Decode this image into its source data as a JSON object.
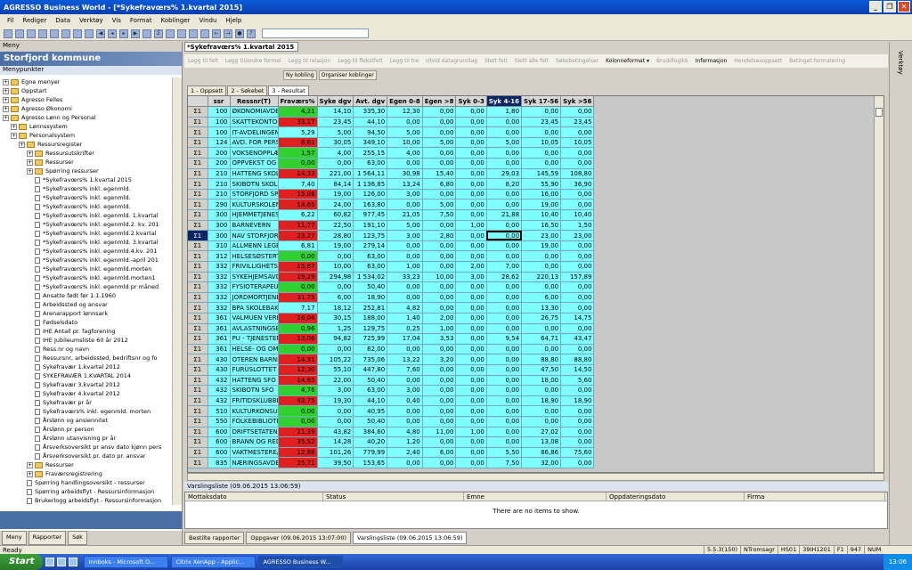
{
  "window": {
    "title": "AGRESSO Business World - [*Sykefravœrs% 1.kvartal 2015]"
  },
  "menu": [
    "Fil",
    "Rediger",
    "Data",
    "Verktøy",
    "Vis",
    "Format",
    "Koblinger",
    "Vindu",
    "Hjelp"
  ],
  "left": {
    "header": "Meny",
    "title": "Storfjord kommune",
    "subheader": "Menypunkter",
    "tree": [
      {
        "indent": 0,
        "type": "folder",
        "label": "Egne menyer"
      },
      {
        "indent": 0,
        "type": "folder",
        "label": "Oppstart"
      },
      {
        "indent": 0,
        "type": "folder",
        "label": "Agresso Felles"
      },
      {
        "indent": 0,
        "type": "folder",
        "label": "Agresso Økonomi"
      },
      {
        "indent": 0,
        "type": "folder",
        "label": "Agresso Lønn og Personal"
      },
      {
        "indent": 1,
        "type": "folder",
        "label": "Lønnssystem"
      },
      {
        "indent": 1,
        "type": "folder",
        "label": "Personalsystem"
      },
      {
        "indent": 2,
        "type": "folder",
        "label": "Ressursregister"
      },
      {
        "indent": 3,
        "type": "folder",
        "label": "Ressursutskrifter"
      },
      {
        "indent": 3,
        "type": "folder",
        "label": "Ressurser"
      },
      {
        "indent": 3,
        "type": "folder",
        "label": "Spørring ressurser"
      },
      {
        "indent": 4,
        "type": "doc",
        "label": "*Sykefravœrs% 1.kvartal 2015"
      },
      {
        "indent": 4,
        "type": "doc",
        "label": "*Sykefravœrs% inkl. egenmld."
      },
      {
        "indent": 4,
        "type": "doc",
        "label": "*Sykefravœrs% inkl. egenmld."
      },
      {
        "indent": 4,
        "type": "doc",
        "label": "*Sykefravœrs% inkl. egenmld."
      },
      {
        "indent": 4,
        "type": "doc",
        "label": "*Sykefravœrs% inkl. egenmld. 1.kvartal"
      },
      {
        "indent": 4,
        "type": "doc",
        "label": "*Sykefravœrs% inkl. egenmld.2. kv. 201"
      },
      {
        "indent": 4,
        "type": "doc",
        "label": "*Sykefravœrs% inkl. egenmld.2.kvartal"
      },
      {
        "indent": 4,
        "type": "doc",
        "label": "*Sykefravœrs% inkl. egenmld. 3.kvartal"
      },
      {
        "indent": 4,
        "type": "doc",
        "label": "*Sykefravœrs% inkl. egenmld.4.kv. 201"
      },
      {
        "indent": 4,
        "type": "doc",
        "label": "*Sykefravœrs% inkl. egenmld.-april 201"
      },
      {
        "indent": 4,
        "type": "doc",
        "label": "*Sykefravœrs% inkl. egenmld.morten"
      },
      {
        "indent": 4,
        "type": "doc",
        "label": "*Sykefravœrs% inkl. egenmld.morten1"
      },
      {
        "indent": 4,
        "type": "doc",
        "label": "*Sykefravœrs% inkl. egenmld pr måned"
      },
      {
        "indent": 4,
        "type": "doc",
        "label": "Ansatte født før 1.1.1960"
      },
      {
        "indent": 4,
        "type": "doc",
        "label": "Arbeidssted og ansvar"
      },
      {
        "indent": 4,
        "type": "doc",
        "label": "Arenarapport lønnsark"
      },
      {
        "indent": 4,
        "type": "doc",
        "label": "Fødselsdato"
      },
      {
        "indent": 4,
        "type": "doc",
        "label": "IHE Antall pr. fagforening"
      },
      {
        "indent": 4,
        "type": "doc",
        "label": "IHE Jubileumsliste 60 år 2012"
      },
      {
        "indent": 4,
        "type": "doc",
        "label": "Ress.nr og navn"
      },
      {
        "indent": 4,
        "type": "doc",
        "label": "Ressursnr, arbeidssted, bedriftsnr og fo"
      },
      {
        "indent": 4,
        "type": "doc",
        "label": "Sykefravær 1.kvartal 2012"
      },
      {
        "indent": 4,
        "type": "doc",
        "label": "SYKEFRAVÆR 1.KVARTAL 2014"
      },
      {
        "indent": 4,
        "type": "doc",
        "label": "Sykefravær 3.kvartal 2012"
      },
      {
        "indent": 4,
        "type": "doc",
        "label": "Sykefravær 4.kvartal 2012"
      },
      {
        "indent": 4,
        "type": "doc",
        "label": "Sykefravær pr år"
      },
      {
        "indent": 4,
        "type": "doc",
        "label": "Sykefravœrs% inkl. egenmld. morten"
      },
      {
        "indent": 4,
        "type": "doc",
        "label": "Årslønn og ansiennitet"
      },
      {
        "indent": 4,
        "type": "doc",
        "label": "Årslønn pr person"
      },
      {
        "indent": 4,
        "type": "doc",
        "label": "Årslønn utanvisning pr år"
      },
      {
        "indent": 4,
        "type": "doc",
        "label": "Årsverksoversikt pr ansv dato kjønn pers"
      },
      {
        "indent": 4,
        "type": "doc",
        "label": "Årsverksoversikt pr. dato pr. ansvar"
      },
      {
        "indent": 3,
        "type": "folder",
        "label": "Ressurser"
      },
      {
        "indent": 3,
        "type": "folder",
        "label": "Fraværsregistrering"
      },
      {
        "indent": 3,
        "type": "doc",
        "label": "Spørring handlingsoversikt - ressurser"
      },
      {
        "indent": 3,
        "type": "doc",
        "label": "Spørring arbeidsflyt - Ressursinformasjon"
      },
      {
        "indent": 3,
        "type": "doc",
        "label": "Brukerlogg arbeidsflyt - Ressursinformasjon"
      },
      {
        "indent": 3,
        "type": "doc",
        "label": "Status arbeidsflyt - ressursendringer"
      }
    ],
    "tabs": [
      "Meny",
      "Rapporter",
      "Søk"
    ]
  },
  "doc_tab": "*Sykefravœrs% 1.kvartal 2015",
  "toolstrip": [
    {
      "label": "Legg til felt",
      "on": false
    },
    {
      "label": "Legg til/endre formel",
      "on": false
    },
    {
      "label": "Legg til relasjon",
      "on": false
    },
    {
      "label": "Legg til flekstfelt",
      "on": false
    },
    {
      "label": "Legg til tre",
      "on": false
    },
    {
      "label": "Utvid datagrunnlag",
      "on": false
    },
    {
      "label": "Slett felt",
      "on": false
    },
    {
      "label": "Slett alle felt",
      "on": false
    },
    {
      "label": "Søkebetingelser",
      "on": false
    },
    {
      "label": "Kolonneformat ▾",
      "on": true
    },
    {
      "label": "Bruddlogikk",
      "on": false
    },
    {
      "label": "Informasjon",
      "on": true
    },
    {
      "label": "Hendelsesoppsett",
      "on": false
    },
    {
      "label": "Betinget formatering",
      "on": false
    }
  ],
  "subbar": [
    "Ny kobling",
    "Organiser koblinger"
  ],
  "result_tabs": [
    "1 - Oppsett",
    "2 - Søkebet",
    "3 - Resultat"
  ],
  "grid": {
    "columns": [
      "",
      "ssr",
      "Ressnr(T)",
      "Fraværs%",
      "Syke dgv",
      "Avt. dgv",
      "Egen 0-8",
      "Egen >8",
      "Syk 0-3",
      "Syk 4-16",
      "Syk 17-56",
      "Syk >56"
    ],
    "rows": [
      [
        "100",
        "ØKONOMIAVDELING",
        "4,21",
        "14,10",
        "335,30",
        "12,30",
        "0,00",
        "0,00",
        "1,80",
        "0,00",
        "0,00",
        "g"
      ],
      [
        "100",
        "SKATTEKONTORET",
        "33,17",
        "23,45",
        "44,10",
        "0,00",
        "0,00",
        "0,00",
        "0,00",
        "23,45",
        "23,45",
        "r"
      ],
      [
        "100",
        "IT-AVDELINGEN",
        "5,29",
        "5,00",
        "94,50",
        "5,00",
        "0,00",
        "0,00",
        "0,00",
        "0,00",
        "0,00",
        ""
      ],
      [
        "124",
        "AVD. FOR PERSONAL",
        "8,61",
        "30,05",
        "349,10",
        "10,00",
        "5,00",
        "0,00",
        "5,00",
        "10,05",
        "10,05",
        "r"
      ],
      [
        "200",
        "VOKSENOPPLÆRING",
        "1,57",
        "4,00",
        "255,15",
        "4,00",
        "0,00",
        "0,00",
        "0,00",
        "0,00",
        "0,00",
        "g"
      ],
      [
        "200",
        "OPPVEKST OG KULT",
        "0,00",
        "0,00",
        "63,00",
        "0,00",
        "0,00",
        "0,00",
        "0,00",
        "0,00",
        "0,00",
        "g"
      ],
      [
        "210",
        "HATTENG SKOLE",
        "14,33",
        "221,00",
        "1 564,11",
        "30,98",
        "15,40",
        "0,00",
        "29,03",
        "145,59",
        "108,80",
        "r"
      ],
      [
        "210",
        "SKIBOTN SKOLE",
        "7,40",
        "84,14",
        "1 136,85",
        "13,24",
        "6,80",
        "0,00",
        "8,20",
        "55,90",
        "36,90",
        ""
      ],
      [
        "210",
        "STORFJORD SPRÅK",
        "15,08",
        "19,00",
        "126,00",
        "3,00",
        "0,00",
        "0,00",
        "0,00",
        "16,00",
        "0,00",
        "r"
      ],
      [
        "290",
        "KULTURSKOLEN",
        "14,65",
        "24,00",
        "163,80",
        "0,00",
        "5,00",
        "0,00",
        "0,00",
        "19,00",
        "0,00",
        "r"
      ],
      [
        "300",
        "HJEMMETJENESTEN",
        "6,22",
        "60,82",
        "977,45",
        "21,05",
        "7,50",
        "0,00",
        "21,88",
        "10,40",
        "10,40",
        ""
      ],
      [
        "300",
        "BARNEVERN",
        "11,77",
        "22,50",
        "191,10",
        "5,00",
        "0,00",
        "1,00",
        "0,00",
        "16,50",
        "1,50",
        "r"
      ],
      [
        "300",
        "NAV STORFJORD",
        "23,27",
        "28,80",
        "123,75",
        "3,00",
        "2,80",
        "0,00",
        "0,00",
        "23,00",
        "23,00",
        "r"
      ],
      [
        "310",
        "ALLMENN LEGETJEN",
        "6,81",
        "19,00",
        "279,14",
        "0,00",
        "0,00",
        "0,00",
        "0,00",
        "19,00",
        "0,00",
        ""
      ],
      [
        "312",
        "HELSESØSTERTJEN",
        "0,00",
        "0,00",
        "63,00",
        "0,00",
        "0,00",
        "0,00",
        "0,00",
        "0,00",
        "0,00",
        "g"
      ],
      [
        "332",
        "FRIVILLIGHETSENTR",
        "15,87",
        "10,00",
        "63,00",
        "1,00",
        "0,00",
        "2,00",
        "7,00",
        "0,00",
        "0,00",
        "r"
      ],
      [
        "332",
        "SYKEHJEMSAVDELI",
        "19,29",
        "294,98",
        "1 534,02",
        "33,23",
        "10,00",
        "3,00",
        "28,62",
        "220,13",
        "157,89",
        "r"
      ],
      [
        "332",
        "FYSIOTERAPEUT",
        "0,00",
        "0,00",
        "50,40",
        "0,00",
        "0,00",
        "0,00",
        "0,00",
        "0,00",
        "0,00",
        "g"
      ],
      [
        "332",
        "JORDMORTJENESTE",
        "31,75",
        "6,00",
        "18,90",
        "0,00",
        "0,00",
        "0,00",
        "0,00",
        "6,00",
        "0,00",
        "r"
      ],
      [
        "332",
        "BPA SKOLEBAKKEN",
        "7,17",
        "18,12",
        "252,81",
        "4,82",
        "0,00",
        "0,00",
        "0,00",
        "13,30",
        "0,00",
        ""
      ],
      [
        "361",
        "VALMUEN VERKSTE",
        "16,04",
        "30,15",
        "188,00",
        "1,40",
        "2,00",
        "0,00",
        "0,00",
        "26,75",
        "14,75",
        "r"
      ],
      [
        "361",
        "AVLASTNINGSBOLI",
        "0,96",
        "1,25",
        "129,75",
        "0,25",
        "1,00",
        "0,00",
        "0,00",
        "0,00",
        "0,00",
        "g"
      ],
      [
        "361",
        "PU - TJENESTEN",
        "13,06",
        "94,82",
        "725,99",
        "17,04",
        "3,53",
        "0,00",
        "9,54",
        "64,71",
        "43,47",
        "r"
      ],
      [
        "361",
        "HELSE- OG OMSORG",
        "0,00",
        "0,00",
        "62,00",
        "0,00",
        "0,00",
        "0,00",
        "0,00",
        "0,00",
        "0,00",
        "g"
      ],
      [
        "430",
        "OTEREN BARNEHAG",
        "14,31",
        "105,22",
        "735,06",
        "13,22",
        "3,20",
        "0,00",
        "0,00",
        "88,80",
        "88,80",
        "r"
      ],
      [
        "430",
        "FURUSLOTTET BARN",
        "12,30",
        "55,10",
        "447,80",
        "7,60",
        "0,00",
        "0,00",
        "0,00",
        "47,50",
        "14,50",
        "r"
      ],
      [
        "432",
        "HATTENG SFO",
        "14,65",
        "22,00",
        "50,40",
        "0,00",
        "0,00",
        "0,00",
        "0,00",
        "18,00",
        "5,60",
        "r"
      ],
      [
        "432",
        "SKIBOTN SFO",
        "4,76",
        "3,00",
        "63,00",
        "3,00",
        "0,00",
        "0,00",
        "0,00",
        "0,00",
        "0,00",
        "g"
      ],
      [
        "432",
        "FRITIDSKLUBBER",
        "43,75",
        "19,30",
        "44,10",
        "0,40",
        "0,00",
        "0,00",
        "0,00",
        "18,90",
        "18,90",
        "r"
      ],
      [
        "510",
        "KULTURKONSULENT",
        "0,00",
        "0,00",
        "40,95",
        "0,00",
        "0,00",
        "0,00",
        "0,00",
        "0,00",
        "0,00",
        "g"
      ],
      [
        "550",
        "FOLKEBIBLIOTEK",
        "0,00",
        "0,00",
        "50,40",
        "0,00",
        "0,00",
        "0,00",
        "0,00",
        "0,00",
        "0,00",
        "g"
      ],
      [
        "600",
        "DRIFTSETATEN ADM",
        "11,39",
        "43,82",
        "384,60",
        "4,80",
        "11,00",
        "1,00",
        "0,00",
        "27,02",
        "0,00",
        "r"
      ],
      [
        "600",
        "BRANN OG REDNING",
        "35,52",
        "14,28",
        "40,20",
        "1,20",
        "0,00",
        "0,00",
        "0,00",
        "13,08",
        "0,00",
        "r"
      ],
      [
        "600",
        "VAKTMESTERE/REN",
        "12,88",
        "101,26",
        "779,99",
        "2,40",
        "6,00",
        "0,00",
        "5,50",
        "86,86",
        "75,60",
        "r"
      ],
      [
        "835",
        "NÆRINGSAVDELING",
        "25,71",
        "39,50",
        "153,65",
        "0,00",
        "0,00",
        "0,00",
        "7,50",
        "32,00",
        "0,00",
        "r"
      ]
    ]
  },
  "warnings": {
    "header": "Varslingsliste (09.06.2015 13:06:59)",
    "columns": [
      "Mottaksdato",
      "Status",
      "Emne",
      "Oppdateringsdato",
      "Firma"
    ],
    "empty_text": "There are no items to show."
  },
  "doc_tabs": [
    "Bestilte rapporter",
    "Oppgaver (09.06.2015 13:07:00)",
    "Varslingsliste (09.06.2015 13:06:59)"
  ],
  "right_bar_label": "Verktøy",
  "status": {
    "left": "Ready",
    "cells": [
      "5.5.3(150)",
      "NTromsagr",
      "HS01",
      "39IH1201",
      "F1",
      "947",
      "NUM"
    ]
  },
  "taskbar": {
    "start": "Start",
    "tasks": [
      "Innboks - Microsoft O...",
      "Citrix XenApp - Applic...",
      "AGRESSO Business W..."
    ],
    "clock": "13:06"
  },
  "colors": {
    "cyan": "#7fffff",
    "red": "#e02020",
    "green": "#30d030",
    "selected": "#0a246a"
  }
}
